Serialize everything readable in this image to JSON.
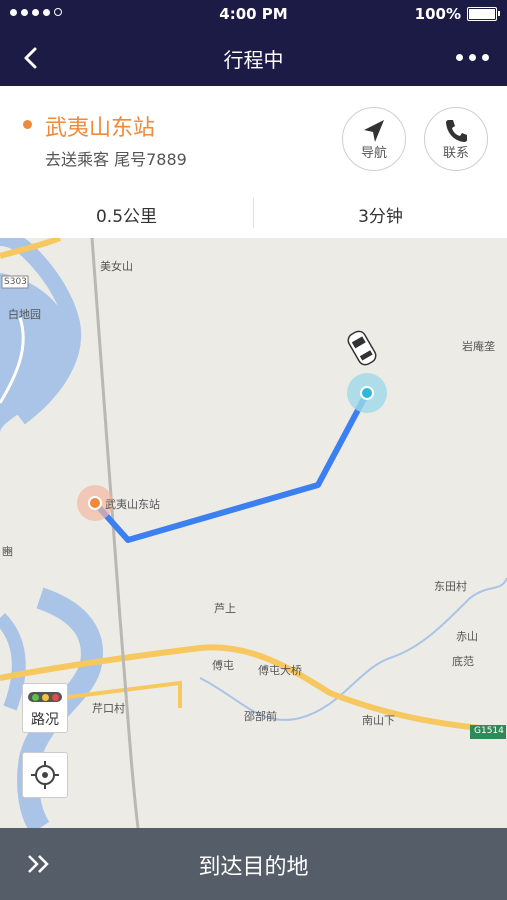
{
  "status_bar": {
    "time": "4:00 PM",
    "battery": "100%",
    "signal_dots": 5
  },
  "nav": {
    "title": "行程中",
    "back_icon": "chevron-left-icon",
    "more_icon": "more-dots-icon"
  },
  "trip": {
    "station": "武夷山东站",
    "passenger_info": "去送乘客  尾号7889",
    "navigate_label": "导航",
    "contact_label": "联系"
  },
  "stats": {
    "distance": "0.5公里",
    "time": "3分钟"
  },
  "map": {
    "places": [
      "美女山",
      "白地园",
      "岩庵垄",
      "武夷山东站",
      "芦上",
      "东田村",
      "赤山",
      "底范",
      "傅屯",
      "傅屯大桥",
      "芹口村",
      "邵部前",
      "南山下",
      "豳"
    ],
    "road_labels": [
      "S303",
      "G1514"
    ],
    "traffic_label": "路况",
    "colors": {
      "route": "#3b7ff0",
      "road": "#f6c85f",
      "water": "#a9c4e6",
      "background": "#ecebe6"
    }
  },
  "bottom": {
    "action": "到达目的地"
  }
}
